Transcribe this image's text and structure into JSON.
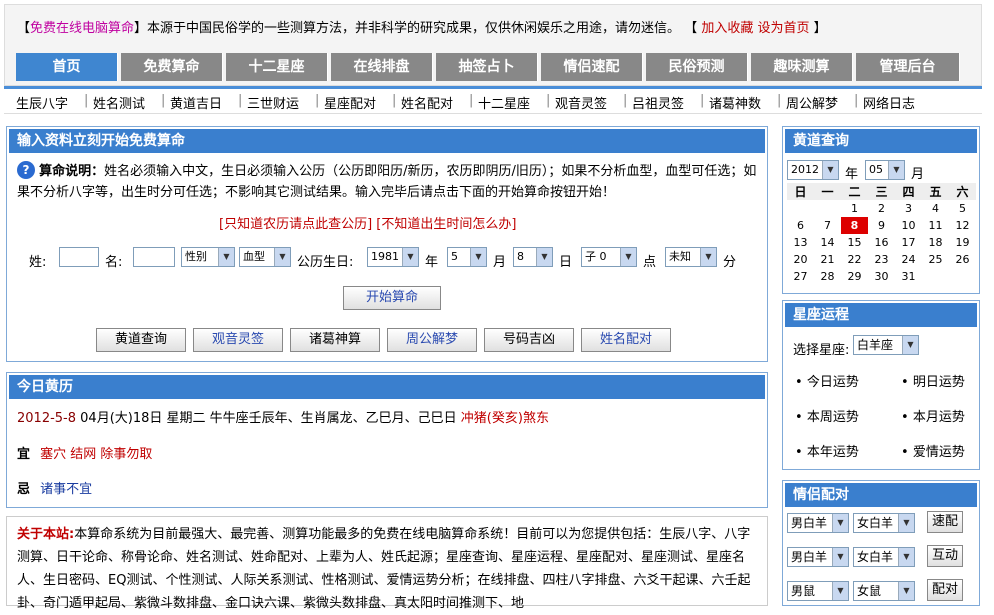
{
  "header": {
    "bracket_open": "【",
    "brand": "免费在线电脑算命",
    "bracket_close": "】",
    "notice": "本源于中国民俗学的一些测算方法，并非科学的研究成果，仅供休闲娱乐之用途，请勿迷信。",
    "links_open": "【",
    "add_fav": "加入收藏",
    "set_home": "设为首页",
    "links_close": "】"
  },
  "tabs": [
    "首页",
    "免费算命",
    "十二星座",
    "在线排盘",
    "抽签占卜",
    "情侣速配",
    "民俗预测",
    "趣味测算",
    "管理后台"
  ],
  "subnav": [
    "生辰八字",
    "姓名测试",
    "黄道吉日",
    "三世财运",
    "星座配对",
    "姓名配对",
    "十二星座",
    "观音灵签",
    "吕祖灵签",
    "诸葛神数",
    "周公解梦",
    "网络日志"
  ],
  "fortune": {
    "title": "输入资料立刻开始免费算命",
    "help_label": "算命说明：",
    "help_text": "姓名必须输入中文，生日必须输入公历（公历即阳历/新历，农历即阴历/旧历）；如果不分析血型，血型可任选；如果不分析八字等，出生时分可任选；不影响其它测试结果。输入完毕后请点击下面的开始算命按钮开始！",
    "link1": "[只知道农历请点此查公历]",
    "link2": "[不知道出生时间怎么办]",
    "surname_label": "姓:",
    "name_label": "名:",
    "gender": "性别",
    "blood": "血型",
    "birth_label": "公历生日:",
    "year": "1981",
    "year_unit": "年",
    "month": "5",
    "month_unit": "月",
    "day": "8",
    "day_unit": "日",
    "hour": "子 0",
    "hour_unit": "点",
    "minute": "未知",
    "minute_unit": "分",
    "start_button": "开始算命",
    "quick_buttons": [
      "黄道查询",
      "观音灵签",
      "诸葛神算",
      "周公解梦",
      "号码吉凶",
      "姓名配对"
    ]
  },
  "almanac": {
    "title": "今日黄历",
    "date": "2012-5-8",
    "info": "04月(大)18日 星期二 牛牛座壬辰年、生肖属龙、乙巳月、己巳日",
    "clash": "冲猪(癸亥)煞东",
    "yi_label": "宜",
    "yi": "塞穴 结网 除事勿取",
    "ji_label": "忌",
    "ji": "诸事不宜"
  },
  "about": {
    "label": "关于本站:",
    "text": "本算命系统为目前最强大、最完善、测算功能最多的免费在线电脑算命系统！目前可以为您提供包括：生辰八字、八字测算、日干论命、称骨论命、姓名测试、姓命配对、上辈为人、姓氏起源；星座查询、星座运程、星座配对、星座测试、星座名人、生日密码、EQ测试、个性测试、人际关系测试、性格测试、爱情运势分析；在线排盘、四柱八字排盘、六爻干起课、六壬起卦、奇门遁甲起局、紫微斗数排盘、金口诀六课、紫微头数排盘、真太阳时间推测下、地"
  },
  "calendar": {
    "title": "黄道查询",
    "year": "2012",
    "year_unit": "年",
    "month": "05",
    "month_unit": "月",
    "weekdays": [
      "日",
      "一",
      "二",
      "三",
      "四",
      "五",
      "六"
    ],
    "weeks": [
      [
        "",
        "",
        "1",
        "2",
        "3",
        "4",
        "5"
      ],
      [
        "6",
        "7",
        "8",
        "9",
        "10",
        "11",
        "12"
      ],
      [
        "13",
        "14",
        "15",
        "16",
        "17",
        "18",
        "19"
      ],
      [
        "20",
        "21",
        "22",
        "23",
        "24",
        "25",
        "26"
      ],
      [
        "27",
        "28",
        "29",
        "30",
        "31",
        "",
        ""
      ]
    ],
    "today": "8"
  },
  "horoscope": {
    "title": "星座运程",
    "select_label": "选择星座:",
    "sign": "白羊座",
    "items": [
      "今日运势",
      "明日运势",
      "本周运势",
      "本月运势",
      "本年运势",
      "爱情运势"
    ]
  },
  "match": {
    "title": "情侣配对",
    "rows": [
      {
        "a": "男白羊",
        "b": "女白羊",
        "btn": "速配"
      },
      {
        "a": "男白羊",
        "b": "女白羊",
        "btn": "互动"
      },
      {
        "a": "男鼠",
        "b": "女鼠",
        "btn": "配对"
      }
    ]
  }
}
